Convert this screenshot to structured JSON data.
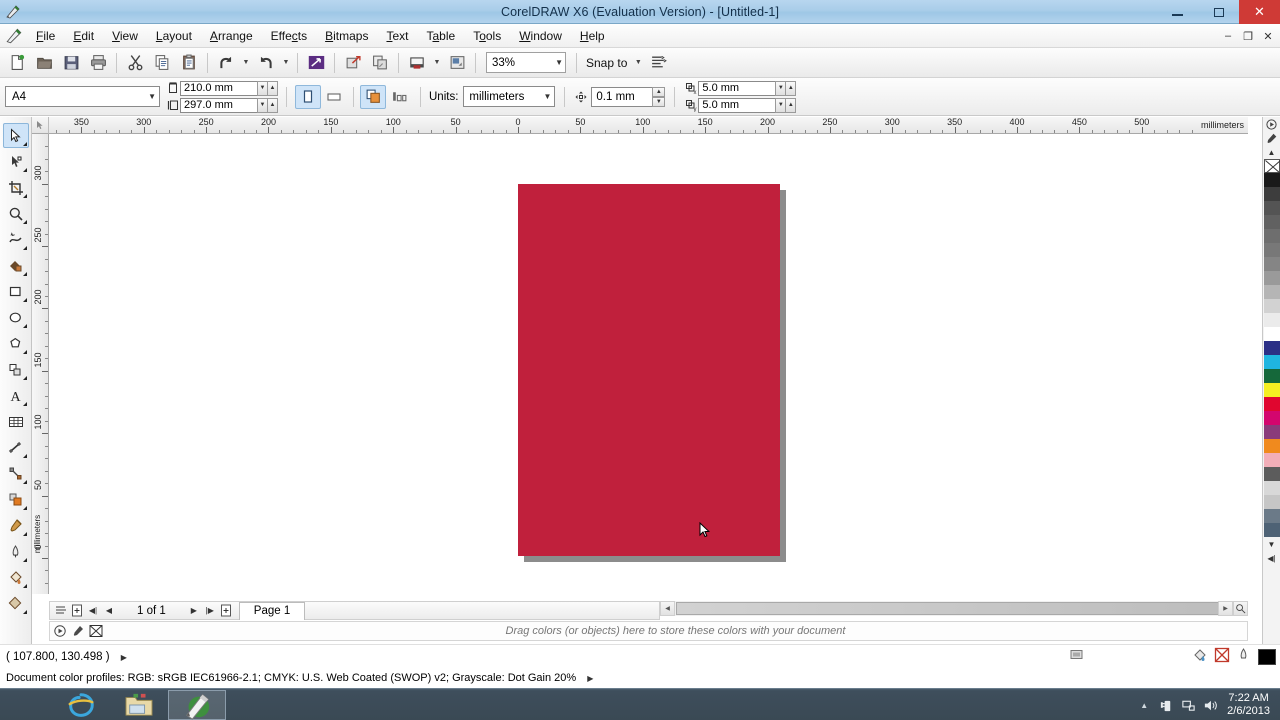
{
  "window": {
    "title": "CorelDRAW X6 (Evaluation Version) - [Untitled-1]",
    "app_icon": "coreldraw-icon",
    "minimize": "–",
    "maximize": "❐",
    "close": "✕"
  },
  "menu": {
    "items": [
      {
        "label": "File",
        "accel": "F"
      },
      {
        "label": "Edit",
        "accel": "E"
      },
      {
        "label": "View",
        "accel": "V"
      },
      {
        "label": "Layout",
        "accel": "L"
      },
      {
        "label": "Arrange",
        "accel": "A"
      },
      {
        "label": "Effects",
        "accel": "c"
      },
      {
        "label": "Bitmaps",
        "accel": "B"
      },
      {
        "label": "Text",
        "accel": "T"
      },
      {
        "label": "Table",
        "accel": "a"
      },
      {
        "label": "Tools",
        "accel": "o"
      },
      {
        "label": "Window",
        "accel": "W"
      },
      {
        "label": "Help",
        "accel": "H"
      }
    ],
    "doc_minimize": "–",
    "doc_restore": "❐",
    "doc_close": "✕"
  },
  "standard_toolbar": {
    "buttons": [
      {
        "name": "new-document-button",
        "icon": "new-page-icon"
      },
      {
        "name": "open-document-button",
        "icon": "folder-open-icon"
      },
      {
        "name": "save-document-button",
        "icon": "floppy-disk-icon"
      },
      {
        "name": "print-button",
        "icon": "printer-icon"
      },
      {
        "name": "cut-button",
        "icon": "scissors-icon"
      },
      {
        "name": "copy-button",
        "icon": "copy-icon"
      },
      {
        "name": "paste-button",
        "icon": "clipboard-paste-icon"
      },
      {
        "name": "undo-button",
        "icon": "undo-arrow-icon"
      },
      {
        "name": "redo-button",
        "icon": "redo-arrow-icon"
      },
      {
        "name": "search-content-button",
        "icon": "corel-connect-icon"
      },
      {
        "name": "import-button",
        "icon": "import-icon"
      },
      {
        "name": "export-button",
        "icon": "export-icon"
      },
      {
        "name": "publish-pdf-button",
        "icon": "pdf-publish-icon"
      },
      {
        "name": "application-launcher-button",
        "icon": "app-launcher-icon"
      }
    ],
    "zoom_level": "33%",
    "snap_to_label": "Snap to",
    "options_button": "options-icon"
  },
  "property_bar": {
    "page_size": "A4",
    "page_width": "210.0 mm",
    "page_height": "297.0 mm",
    "orientation_portrait": "portrait-icon",
    "orientation_landscape": "landscape-icon",
    "all_pages_icon": "all-pages-icon",
    "current_page_icon": "current-page-icon",
    "units_label": "Units:",
    "units_value": "millimeters",
    "nudge_icon": "nudge-icon",
    "nudge_value": "0.1 mm",
    "duplicate_x_icon": "duplicate-x-icon",
    "duplicate_x": "5.0 mm",
    "duplicate_y_icon": "duplicate-y-icon",
    "duplicate_y": "5.0 mm"
  },
  "rulers": {
    "unit_label": "millimeters",
    "h_labels": [
      "350",
      "300",
      "250",
      "200",
      "150",
      "100",
      "50",
      "0",
      "50",
      "100",
      "150",
      "200",
      "250",
      "300",
      "350",
      "400",
      "450",
      "500"
    ],
    "v_labels": [
      "300",
      "250",
      "200",
      "150",
      "100",
      "50",
      "0"
    ],
    "v_unit_label": "millimeters"
  },
  "toolbox": {
    "tools": [
      {
        "name": "pick-tool",
        "icon": "arrow-cursor-icon",
        "selected": true
      },
      {
        "name": "shape-tool",
        "icon": "node-edit-icon",
        "selected": false
      },
      {
        "name": "crop-tool",
        "icon": "crop-icon",
        "selected": false
      },
      {
        "name": "zoom-tool",
        "icon": "magnifier-icon",
        "selected": false
      },
      {
        "name": "freehand-tool",
        "icon": "freehand-curve-icon",
        "selected": false
      },
      {
        "name": "smart-fill-tool",
        "icon": "smart-fill-icon",
        "selected": false
      },
      {
        "name": "rectangle-tool",
        "icon": "rectangle-icon",
        "selected": false
      },
      {
        "name": "ellipse-tool",
        "icon": "ellipse-icon",
        "selected": false
      },
      {
        "name": "polygon-tool",
        "icon": "polygon-icon",
        "selected": false
      },
      {
        "name": "basic-shapes-tool",
        "icon": "basic-shapes-icon",
        "selected": false
      },
      {
        "name": "text-tool",
        "icon": "letter-a-icon",
        "selected": false
      },
      {
        "name": "table-tool",
        "icon": "table-grid-icon",
        "selected": false
      },
      {
        "name": "dimension-tool",
        "icon": "dimension-line-icon",
        "selected": false
      },
      {
        "name": "connector-tool",
        "icon": "connector-line-icon",
        "selected": false
      },
      {
        "name": "blend-tool",
        "icon": "blend-shapes-icon",
        "selected": false
      },
      {
        "name": "color-eyedropper-tool",
        "icon": "eyedropper-icon",
        "selected": false
      },
      {
        "name": "outline-tool",
        "icon": "pen-nib-icon",
        "selected": false
      },
      {
        "name": "fill-tool",
        "icon": "paint-bucket-icon",
        "selected": false
      },
      {
        "name": "interactive-fill-tool",
        "icon": "interactive-fill-icon",
        "selected": false
      }
    ]
  },
  "canvas": {
    "rect_fill": "#c0203c",
    "page_bg": "#ffffff",
    "page_shadow": "#8c8c8c",
    "cursor": "arrow-cursor"
  },
  "page_nav": {
    "add_page_start_icon": "add-page-icon",
    "first_page_icon": "◀|",
    "prev_page_icon": "◀",
    "page_counter": "1 of 1",
    "next_page_icon": "▶",
    "last_page_icon": "|▶",
    "add_page_end_icon": "add-page-icon",
    "page_tab": "Page 1"
  },
  "document_palette": {
    "hint": "Drag colors (or objects) here to store these colors with your document",
    "buttons": [
      "auto-update-icon",
      "eyedropper-icon",
      "no-color-icon"
    ]
  },
  "status_bar": {
    "coordinates": "( 107.800, 130.498 )",
    "expand_arrow": "▶",
    "color_profiles": "Document color profiles: RGB: sRGB IEC61966-2.1; CMYK: U.S. Web Coated (SWOP) v2; Grayscale: Dot Gain 20%",
    "profiles_arrow": "▶",
    "fill_swatch": "#000000",
    "outline_swatch": "#000000",
    "fill_icon": "fill-color-icon",
    "outline_icon": "outline-color-icon",
    "no_fill_icon": "no-fill-icon"
  },
  "palette": {
    "scroll_up": "▲",
    "scroll_down": "▼",
    "expand": "◀|",
    "no_color_label": "no-color-swatch",
    "swatches": [
      "#1a1a1a",
      "#3d3d3d",
      "#545454",
      "#616161",
      "#6e6e6e",
      "#787878",
      "#858585",
      "#9a9a9a",
      "#b5b5b5",
      "#d2d2d2",
      "#ebebeb",
      "#ffffff",
      "#2b2f86",
      "#1fb5e0",
      "#15683a",
      "#f5ee22",
      "#e0062f",
      "#d3066e",
      "#8a3b7a",
      "#f08a1e",
      "#f2aeb8",
      "#5c5c5c",
      "#d8d8d8",
      "#c6c6c6",
      "#6b7a88",
      "#4e6275"
    ]
  },
  "taskbar": {
    "items": [
      {
        "name": "taskbar-internet-explorer",
        "icon": "ie-icon",
        "active": false
      },
      {
        "name": "taskbar-file-explorer",
        "icon": "folder-icon",
        "active": false
      },
      {
        "name": "taskbar-coreldraw",
        "icon": "coreldraw-icon",
        "active": true
      }
    ],
    "tray": {
      "show_hidden": "▲",
      "icons": [
        "usb-device-icon",
        "network-icon",
        "volume-icon"
      ],
      "time": "7:22 AM",
      "date": "2/6/2013"
    }
  }
}
